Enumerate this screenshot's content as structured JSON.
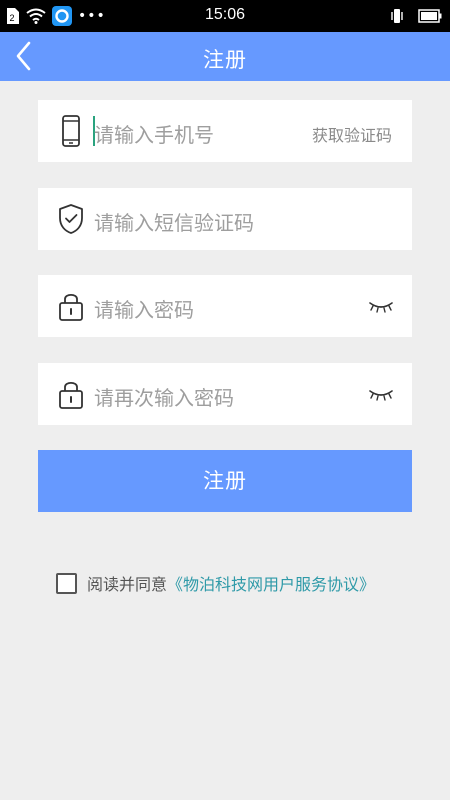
{
  "status_bar": {
    "time": "15:06",
    "indicators_left": [
      "sim-icon",
      "wifi-icon",
      "app-notification-icon"
    ],
    "more": "•••",
    "indicators_right": [
      "vibrate-icon",
      "battery-icon"
    ]
  },
  "nav": {
    "title": "注册",
    "back_icon": "chevron-left-icon"
  },
  "form": {
    "phone": {
      "placeholder": "请输入手机号",
      "icon": "smartphone-icon",
      "action_label": "获取验证码"
    },
    "sms_code": {
      "placeholder": "请输入短信验证码",
      "icon": "shield-check-icon"
    },
    "password": {
      "placeholder": "请输入密码",
      "icon": "lock-icon",
      "toggle_icon": "eye-closed-icon"
    },
    "password_confirm": {
      "placeholder": "请再次输入密码",
      "icon": "lock-icon",
      "toggle_icon": "eye-closed-icon"
    },
    "submit_label": "注册"
  },
  "agreement": {
    "checked": false,
    "text": "阅读并同意",
    "link": "《物泊科技网用户服务协议》"
  },
  "colors": {
    "primary": "#6699ff",
    "background": "#eeeeee",
    "link": "#2f9aa8",
    "caret": "#2aa37f",
    "placeholder": "#9e9e9e"
  }
}
